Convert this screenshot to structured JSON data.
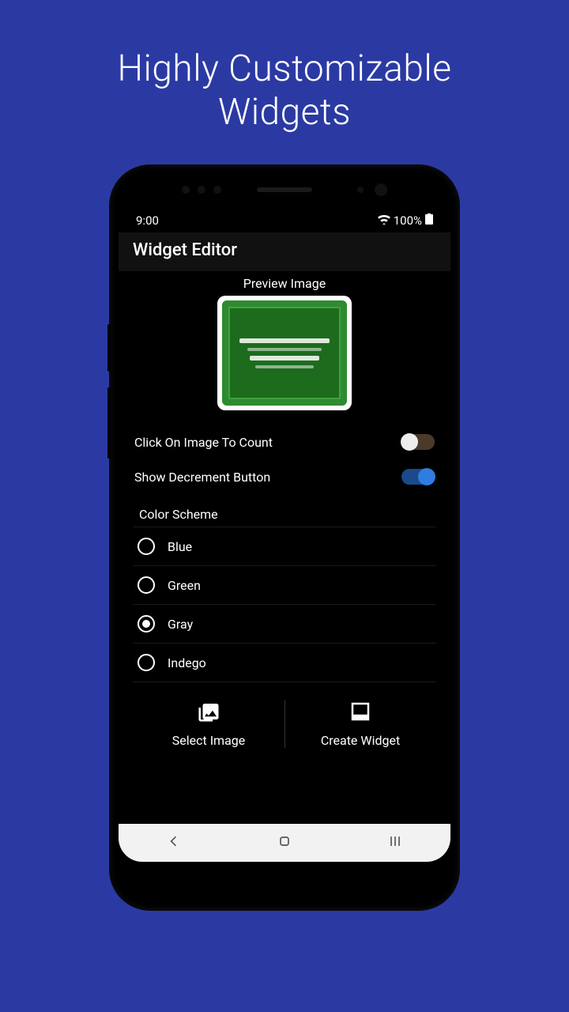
{
  "promo": {
    "line1": "Highly Customizable",
    "line2": "Widgets"
  },
  "statusBar": {
    "time": "9:00",
    "battery": "100%"
  },
  "appBar": {
    "title": "Widget Editor"
  },
  "preview": {
    "label": "Preview Image"
  },
  "settings": {
    "clickToCount": {
      "label": "Click On Image To Count",
      "value": false
    },
    "showDecrement": {
      "label": "Show Decrement Button",
      "value": true
    }
  },
  "colorScheme": {
    "label": "Color Scheme",
    "options": [
      "Blue",
      "Green",
      "Gray",
      "Indego"
    ],
    "selected": "Gray"
  },
  "actions": {
    "selectImage": "Select Image",
    "createWidget": "Create Widget"
  }
}
